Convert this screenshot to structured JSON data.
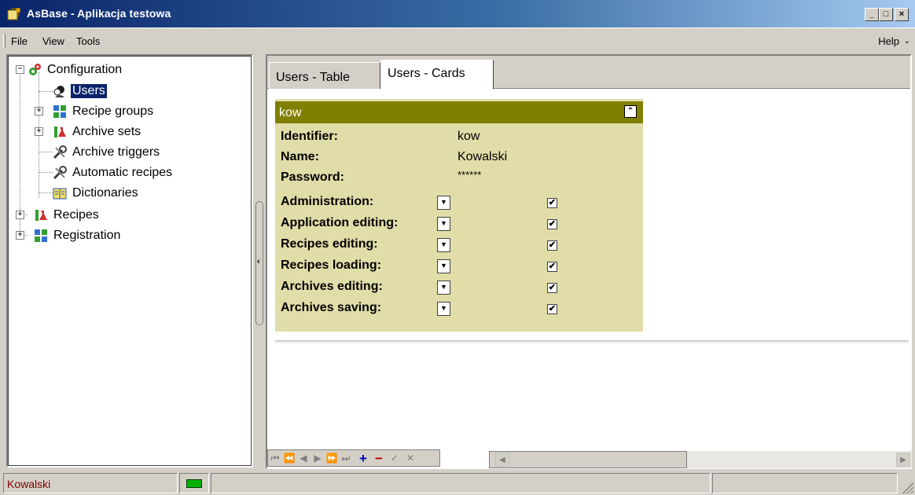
{
  "window": {
    "title": "AsBase - Aplikacja testowa"
  },
  "menu": {
    "items": [
      {
        "label": "File"
      },
      {
        "label": "View"
      },
      {
        "label": "Tools"
      }
    ],
    "help": "Help"
  },
  "tree": {
    "nodes": [
      {
        "label": "Configuration",
        "icon": "gears-icon"
      },
      {
        "label": "Users",
        "icon": "users-icon",
        "selected": true
      },
      {
        "label": "Recipe groups",
        "icon": "recipe-groups-icon"
      },
      {
        "label": "Archive sets",
        "icon": "archive-sets-icon"
      },
      {
        "label": "Archive triggers",
        "icon": "tools-icon"
      },
      {
        "label": "Automatic recipes",
        "icon": "tools-icon"
      },
      {
        "label": "Dictionaries",
        "icon": "book-icon"
      },
      {
        "label": "Recipes",
        "icon": "flask-icon"
      },
      {
        "label": "Registration",
        "icon": "registration-icon"
      }
    ]
  },
  "tabs": [
    {
      "label": "Users - Table"
    },
    {
      "label": "Users - Cards"
    }
  ],
  "card": {
    "header": "kow",
    "fields": [
      {
        "label": "Identifier:",
        "value": "kow"
      },
      {
        "label": "Name:",
        "value": "Kowalski"
      },
      {
        "label": "Password:",
        "value": "******"
      }
    ],
    "permissions": [
      {
        "label": "Administration:",
        "checked": "✔"
      },
      {
        "label": "Application editing:",
        "checked": "✔"
      },
      {
        "label": "Recipes editing:",
        "checked": "✔"
      },
      {
        "label": "Recipes loading:",
        "checked": "✔"
      },
      {
        "label": "Archives editing:",
        "checked": "✔"
      },
      {
        "label": "Archives saving:",
        "checked": "✔"
      }
    ]
  },
  "statusbar": {
    "user": "Kowalski"
  },
  "colors": {
    "title_start": "#0a246a",
    "card_header": "#808000",
    "card_bg": "#e1dda8",
    "selected": "#0a246a"
  }
}
